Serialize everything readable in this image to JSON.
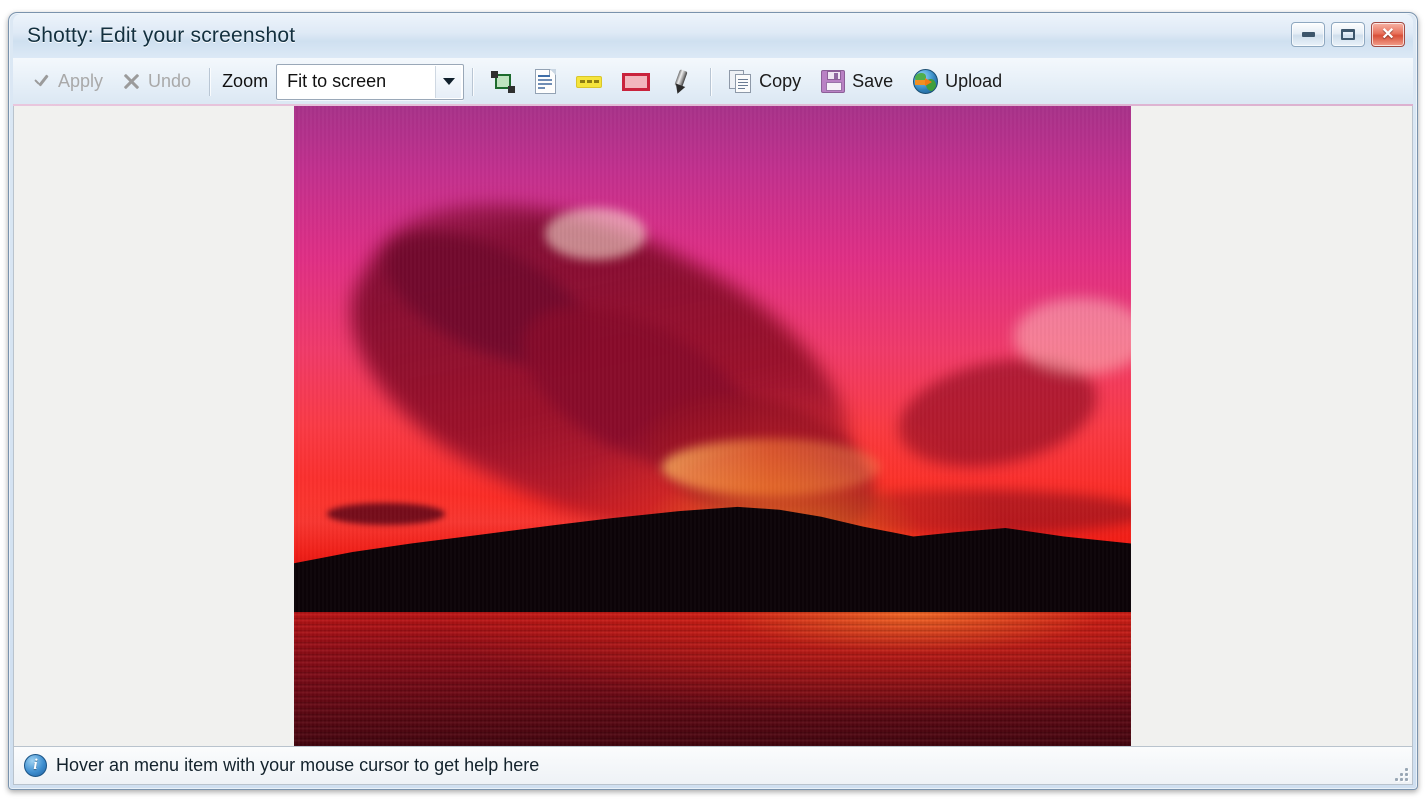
{
  "window": {
    "title": "Shotty: Edit your screenshot",
    "controls": [
      {
        "name": "minimize",
        "label": ""
      },
      {
        "name": "maximize",
        "label": ""
      },
      {
        "name": "close",
        "label": "✕"
      }
    ]
  },
  "toolbar": {
    "apply_label": "Apply",
    "apply_enabled": false,
    "undo_label": "Undo",
    "undo_enabled": false,
    "zoom_label": "Zoom",
    "zoom_value": "Fit to screen",
    "zoom_options": [
      "Fit to screen"
    ],
    "tools": [
      {
        "name": "crop-tool",
        "icon": "crop-icon"
      },
      {
        "name": "text-tool",
        "icon": "text-note-icon"
      },
      {
        "name": "highlighter-tool",
        "icon": "highlighter-icon"
      },
      {
        "name": "rectangle-tool",
        "icon": "rectangle-icon"
      },
      {
        "name": "pen-tool",
        "icon": "pen-icon"
      }
    ],
    "copy_label": "Copy",
    "save_label": "Save",
    "upload_label": "Upload"
  },
  "canvas": {
    "image_alt": "Sunset over water with magenta and red sky, dark clouds and mountain silhouette",
    "background_color": "#f1f1ef"
  },
  "statusbar": {
    "icon": "info-icon",
    "text": "Hover an menu item with your mouse cursor to get help here"
  },
  "colors": {
    "titlebar": "#dfeaf6",
    "toolbar": "#e7f0f8",
    "accent_underline": "#e0b8d3",
    "close_button": "#d84f38"
  }
}
